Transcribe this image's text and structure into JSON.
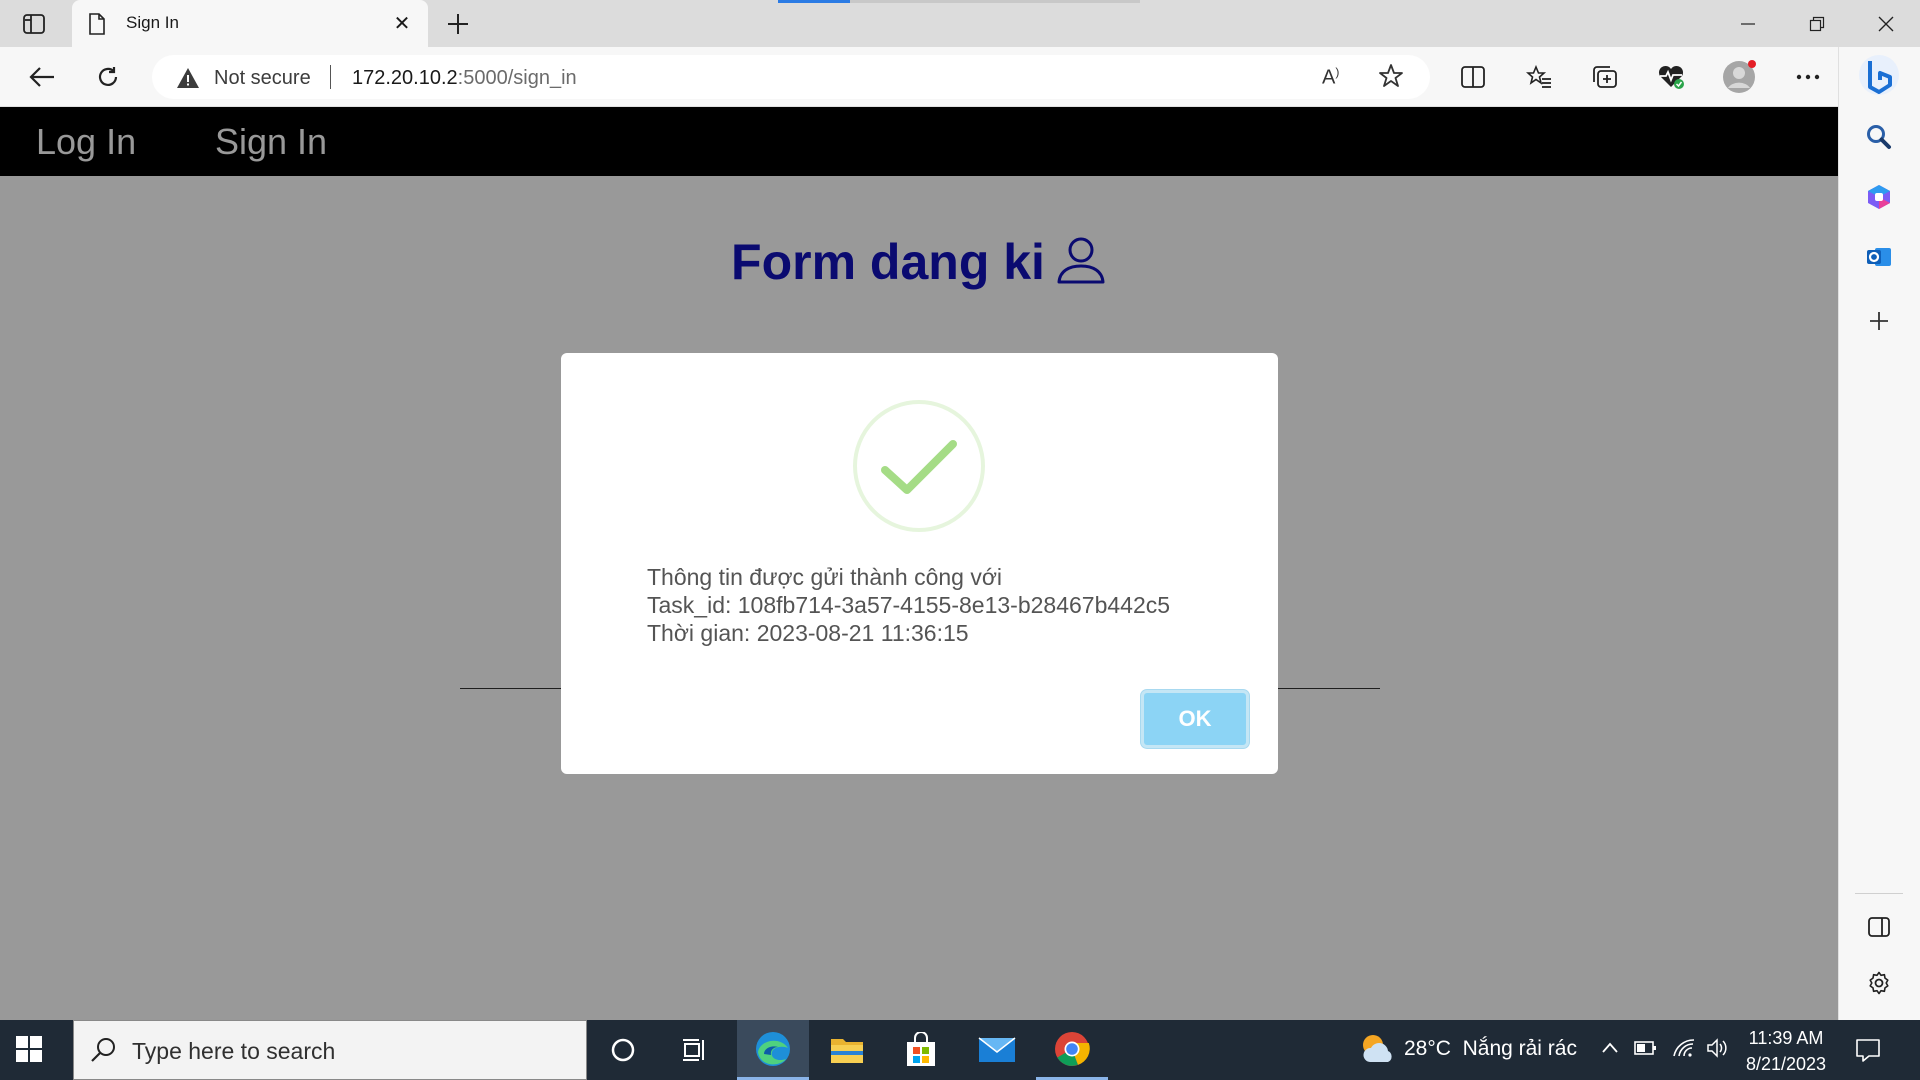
{
  "browser": {
    "tab": {
      "title": "Sign In"
    },
    "address": {
      "security_label": "Not secure",
      "url_host": "172.20.10.2",
      "url_path": ":5000/sign_in"
    }
  },
  "page": {
    "nav": {
      "links": [
        "Log In",
        "Sign In"
      ]
    },
    "form_title": "Form dang ki",
    "modal": {
      "lines": [
        "Thông tin được gửi thành công với",
        "Task_id: 108fb714-3a57-4155-8e13-b28467b442c5",
        "Thời gian: 2023-08-21 11:36:15"
      ],
      "ok_label": "OK",
      "accent_color": "#8cd4f5",
      "success_color": "#a5dc86"
    }
  },
  "taskbar": {
    "search_placeholder": "Type here to search",
    "weather": {
      "temperature": "28°C",
      "condition": "Nắng rải rác"
    },
    "clock": {
      "time": "11:39 AM",
      "date": "8/21/2023"
    },
    "apps": [
      "cortana-icon",
      "task-view-icon",
      "edge-icon",
      "file-explorer-icon",
      "microsoft-store-icon",
      "mail-icon",
      "chrome-icon"
    ]
  }
}
